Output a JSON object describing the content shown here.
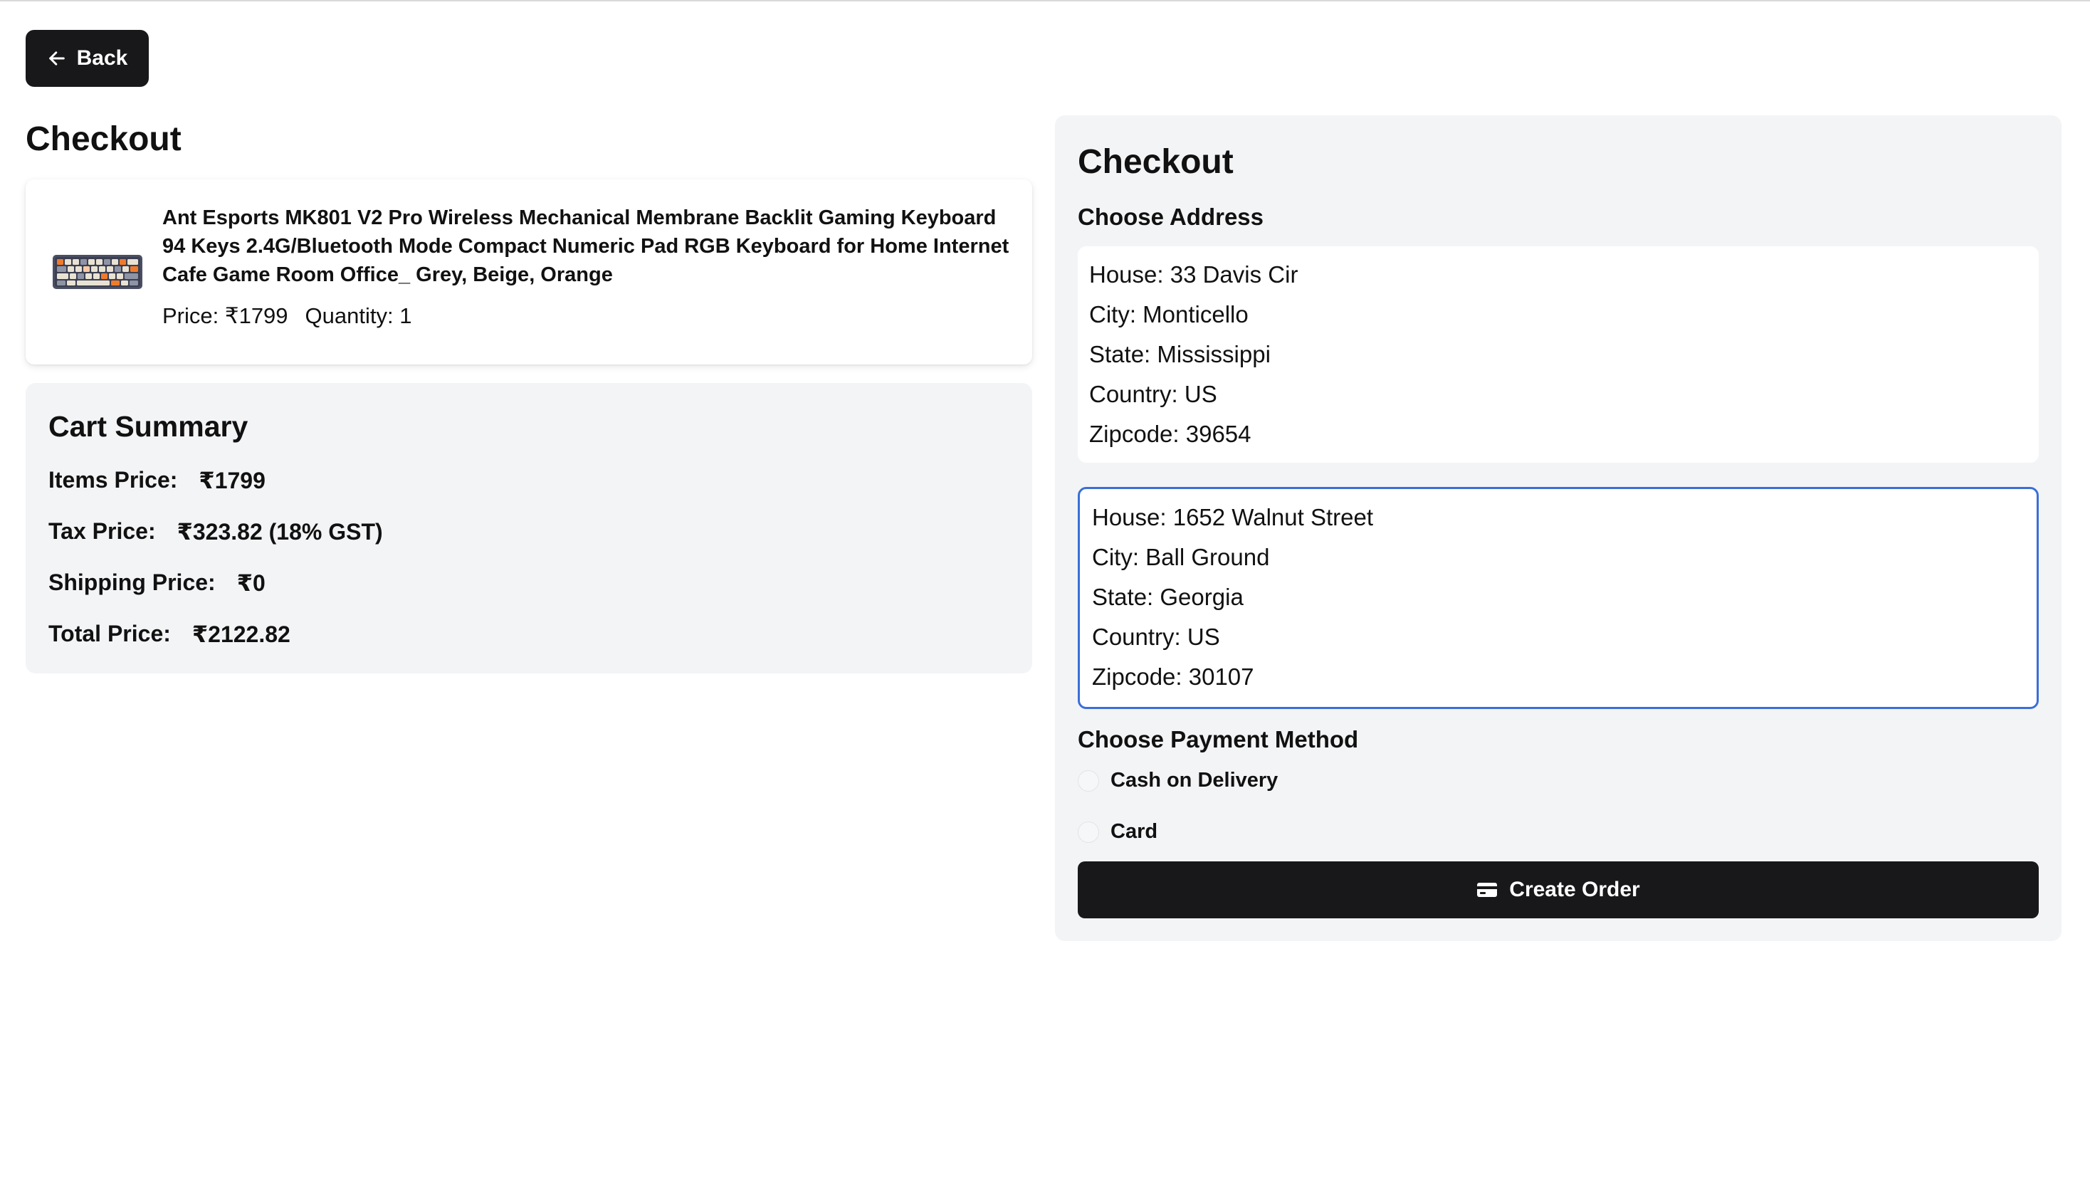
{
  "back_button": {
    "label": "Back",
    "icon": "arrow-left-icon"
  },
  "page_title": "Checkout",
  "cart_items": [
    {
      "name": "Ant Esports MK801 V2 Pro Wireless Mechanical Membrane Backlit Gaming Keyboard 94 Keys 2.4G/Bluetooth Mode Compact Numeric Pad RGB Keyboard for Home Internet Cafe Game Room Office_ Grey, Beige, Orange",
      "price": "Price: ₹1799",
      "quantity": "Quantity: 1"
    }
  ],
  "cart_summary": {
    "title": "Cart Summary",
    "items_price": {
      "label": "Items Price:",
      "value": "₹1799"
    },
    "tax_price": {
      "label": "Tax Price:",
      "value": "₹323.82 (18% GST)"
    },
    "shipping_price": {
      "label": "Shipping Price:",
      "value": "₹0"
    },
    "total_price": {
      "label": "Total Price:",
      "value": "₹2122.82"
    }
  },
  "checkout_panel": {
    "title": "Checkout",
    "choose_address_label": "Choose Address",
    "addresses": [
      {
        "house": "House: 33 Davis Cir",
        "city": "City: Monticello",
        "state": "State: Mississippi",
        "country": "Country: US",
        "zipcode": "Zipcode: 39654",
        "selected": false
      },
      {
        "house": "House: 1652 Walnut Street",
        "city": "City: Ball Ground",
        "state": "State: Georgia",
        "country": "Country: US",
        "zipcode": "Zipcode: 30107",
        "selected": true
      }
    ],
    "payment_label": "Choose Payment Method",
    "payment_options": [
      {
        "label": "Cash on Delivery",
        "selected": false
      },
      {
        "label": "Card",
        "selected": false
      }
    ],
    "create_order_button": {
      "label": "Create Order",
      "icon": "credit-card-icon"
    }
  },
  "colors": {
    "primary_button": "#18181b",
    "panel_background": "#f3f4f6",
    "selected_border": "#3b6fd8"
  }
}
